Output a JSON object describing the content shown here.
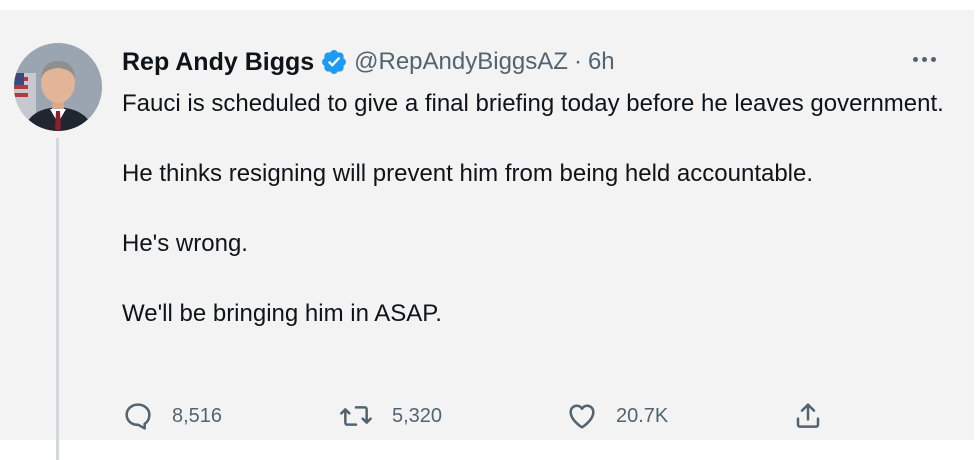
{
  "tweet": {
    "author": {
      "display_name": "Rep Andy Biggs",
      "handle": "@RepAndyBiggsAZ",
      "verified": true
    },
    "separator": "·",
    "timestamp": "6h",
    "paragraphs": [
      "Fauci is scheduled to give a final briefing today before he leaves government.",
      "He thinks resigning will prevent him from being held accountable.",
      "He's wrong.",
      "We'll be bringing him in ASAP."
    ],
    "actions": {
      "reply": {
        "icon": "reply-icon",
        "count": "8,516"
      },
      "retweet": {
        "icon": "retweet-icon",
        "count": "5,320"
      },
      "like": {
        "icon": "heart-icon",
        "count": "20.7K"
      },
      "share": {
        "icon": "share-icon"
      }
    },
    "more_icon": "more-dots-icon"
  },
  "colors": {
    "card_background": "#f3f3f3",
    "verified_blue": "#1d9bf0",
    "secondary_text": "#536471",
    "primary_text": "#0f1419"
  }
}
